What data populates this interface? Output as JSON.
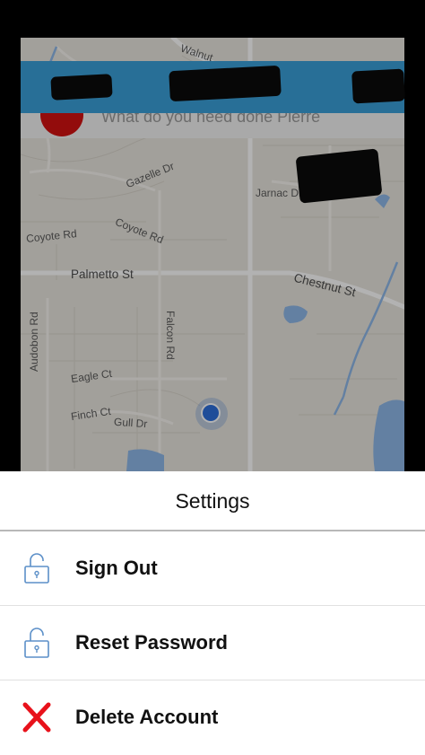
{
  "map": {
    "streets": {
      "walnut": "Walnut",
      "gazelle": "Gazelle Dr",
      "coyote_rd_1": "Coyote Rd",
      "coyote_rd_2": "Coyote Rd",
      "jarnac": "Jarnac Dr",
      "palmetto": "Palmetto St",
      "chestnut": "Chestnut St",
      "audubon": "Audobon Rd",
      "falcon": "Falcon Rd",
      "eagle": "Eagle Ct",
      "finch": "Finch Ct",
      "gull": "Gull Dr"
    },
    "search_prompt": "What do you need done Pierre",
    "colors": {
      "land": "#e9e6df",
      "water": "#8fb8e8",
      "app_bar": "#3a9fd8",
      "avatar": "#d31212",
      "location": "#2d6fdc"
    }
  },
  "settings_sheet": {
    "title": "Settings",
    "items": [
      {
        "label": "Sign Out",
        "icon": "unlocked-padlock-icon"
      },
      {
        "label": "Reset Password",
        "icon": "unlocked-padlock-icon"
      },
      {
        "label": "Delete Account",
        "icon": "red-x-icon"
      }
    ],
    "colors": {
      "padlock": "#5b8fc8",
      "delete_x": "#e8121b"
    }
  }
}
